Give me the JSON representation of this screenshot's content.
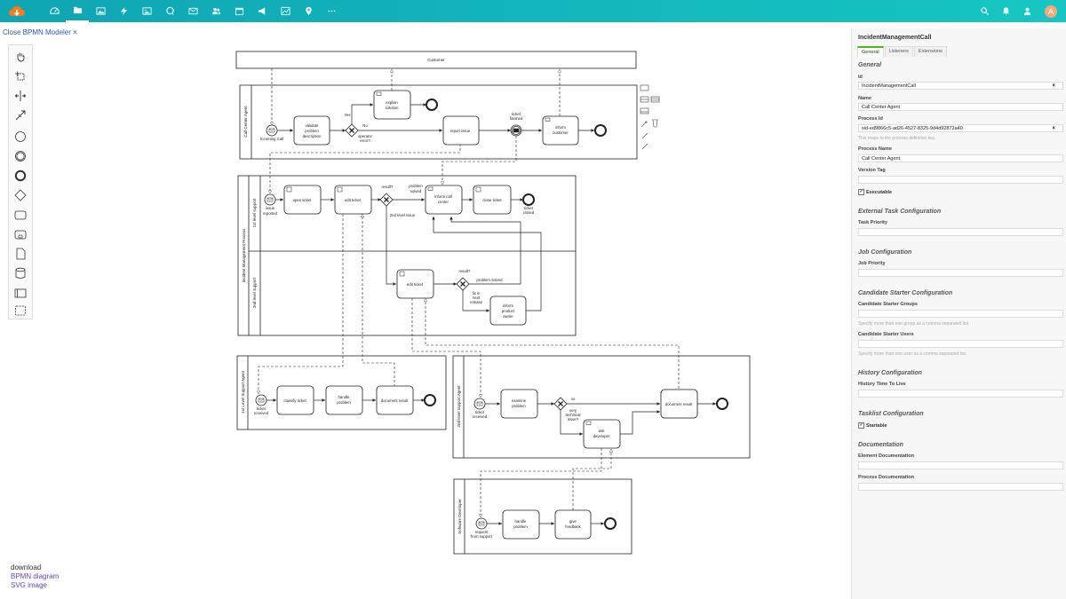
{
  "nav": {
    "icons": [
      "dashboard-icon",
      "folder-icon",
      "image-icon",
      "lightning-icon",
      "photo-icon",
      "chat-icon",
      "mail-icon",
      "users-icon",
      "calendar-icon",
      "megaphone-icon",
      "chart-icon",
      "map-pin-icon",
      "more-icon"
    ],
    "right_icons": [
      "search-icon",
      "bell-icon",
      "user-admin-icon"
    ],
    "avatar_letter": "A"
  },
  "close_modeler": "Close BPMN Modeler ×",
  "download": {
    "heading": "download",
    "bpmn": "BPMN diagram",
    "svg": "SVG image"
  },
  "diagram": {
    "customer": "Customer",
    "pools": {
      "call_center": "Call Center Agent",
      "incident": "Incident Management Process",
      "lane1": "1st level support",
      "lane2": "2nd level support",
      "first_level": "1st Level Support Agent",
      "second_level": "2nd level support Agent",
      "developer": "Software Developer"
    },
    "labels": {
      "incoming_call": "Incoming Call",
      "validate": [
        "validate",
        "problem",
        "description"
      ],
      "yes": "Yes",
      "no": "No",
      "operator_error": [
        "operator",
        "error?"
      ],
      "explain": [
        "explain",
        "solution"
      ],
      "report_issue": "report issue",
      "ticket_finished": [
        "ticket",
        "finished"
      ],
      "inform_customer": [
        "inform",
        "customer"
      ],
      "issue_reported": [
        "issue",
        "reported"
      ],
      "open_ticket": "open ticket",
      "edit_ticket": "edit ticket",
      "result": "result?",
      "problem_solved": [
        "problem",
        "solved"
      ],
      "second_level_issue": "2nd level issue",
      "inform_call_center": [
        "inform call",
        "center"
      ],
      "close_ticket": "close ticket",
      "ticket_closed": [
        "ticket",
        "closed"
      ],
      "edit_ticket2": "edit ticket",
      "result2": "result?",
      "problem_solved2": "problem solved",
      "fix_in_next": [
        "fix in",
        "next",
        "release"
      ],
      "inform_product_owner": [
        "inform",
        "product",
        "owner"
      ],
      "ticket_received": [
        "ticket",
        "received"
      ],
      "classify_ticket": "classify ticket",
      "handle_problem": [
        "handle",
        "problem"
      ],
      "document_result": "document result",
      "ticket_received2": [
        "ticket",
        "received"
      ],
      "examine_problem": [
        "examine",
        "problem"
      ],
      "no2": "no",
      "very_technical": [
        "very",
        "technical",
        "issue?"
      ],
      "ask_developer": [
        "ask",
        "developer"
      ],
      "document_result2": "document result",
      "request_from_support": [
        "request",
        "from support"
      ],
      "handle_problem2": [
        "handle",
        "problem"
      ],
      "give_feedback": [
        "give",
        "feedback"
      ]
    }
  },
  "props": {
    "title": "IncidentManagementCall",
    "tabs": [
      "General",
      "Listeners",
      "Extensions"
    ],
    "general_heading": "General",
    "id_label": "Id",
    "id_value": "IncidentManagementCall",
    "name_label": "Name",
    "name_value": "Call Center Agent",
    "process_id_label": "Process Id",
    "process_id_value": "sid-ed9866c5-ad26-4527-8325-9d4d92872a40",
    "process_id_hint": "This maps to the process definition key.",
    "process_name_label": "Process Name",
    "process_name_value": "Call Center Agent",
    "version_tag_label": "Version Tag",
    "executable_label": "Executable",
    "external_task_heading": "External Task Configuration",
    "task_priority_label": "Task Priority",
    "job_config_heading": "Job Configuration",
    "job_priority_label": "Job Priority",
    "candidate_heading": "Candidate Starter Configuration",
    "candidate_groups_label": "Candidate Starter Groups",
    "candidate_groups_hint": "Specify more than one group as a comma separated list.",
    "candidate_users_label": "Candidate Starter Users",
    "candidate_users_hint": "Specify more than one user as a comma separated list.",
    "history_heading": "History Configuration",
    "history_ttl_label": "History Time To Live",
    "tasklist_heading": "Tasklist Configuration",
    "startable_label": "Startable",
    "documentation_heading": "Documentation",
    "element_doc_label": "Element Documentation",
    "process_doc_label": "Process Documentation"
  }
}
